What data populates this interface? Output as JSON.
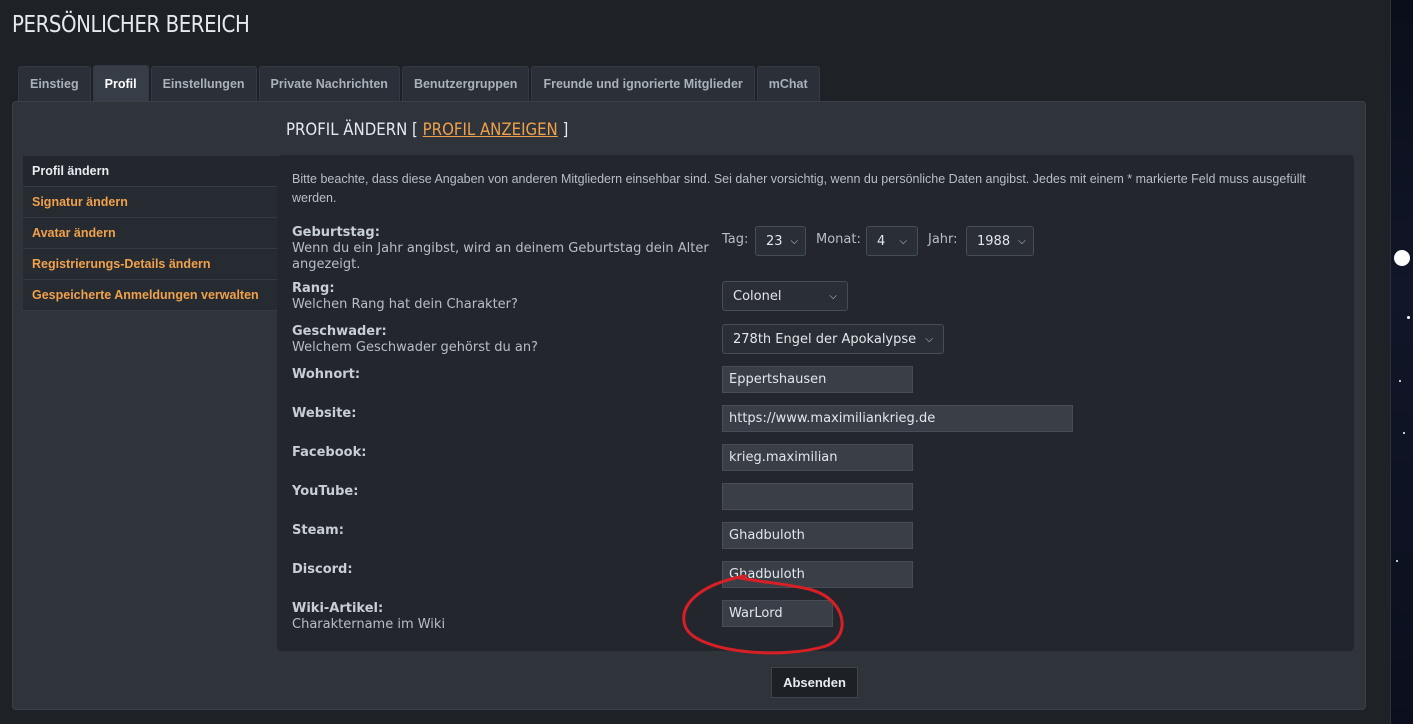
{
  "page_title": "PERSÖNLICHER BEREICH",
  "tabs": [
    {
      "label": "Einstieg",
      "active": false
    },
    {
      "label": "Profil",
      "active": true
    },
    {
      "label": "Einstellungen",
      "active": false
    },
    {
      "label": "Private Nachrichten",
      "active": false
    },
    {
      "label": "Benutzergruppen",
      "active": false
    },
    {
      "label": "Freunde und ignorierte Mitglieder",
      "active": false
    },
    {
      "label": "mChat",
      "active": false
    }
  ],
  "sidebar": {
    "items": [
      {
        "label": "Profil ändern",
        "active": true
      },
      {
        "label": "Signatur ändern",
        "active": false
      },
      {
        "label": "Avatar ändern",
        "active": false
      },
      {
        "label": "Registrierungs-Details ändern",
        "active": false
      },
      {
        "label": "Gespeicherte Anmeldungen verwalten",
        "active": false
      }
    ]
  },
  "content": {
    "heading": "PROFIL ÄNDERN",
    "bracket_open": "[",
    "view_link": "PROFIL ANZEIGEN",
    "bracket_close": "]",
    "intro": "Bitte beachte, dass diese Angaben von anderen Mitgliedern einsehbar sind. Sei daher vorsichtig, wenn du persönliche Daten angibst. Jedes mit einem * markierte Feld muss ausgefüllt werden."
  },
  "birthday": {
    "label": "Geburtstag:",
    "description": "Wenn du ein Jahr angibst, wird an deinem Geburtstag dein Alter angezeigt.",
    "day_label": "Tag:",
    "day_value": "23",
    "month_label": "Monat:",
    "month_value": "4",
    "year_label": "Jahr:",
    "year_value": "1988"
  },
  "rank": {
    "label": "Rang:",
    "description": "Welchen Rang hat dein Charakter?",
    "value": "Colonel"
  },
  "squadron": {
    "label": "Geschwader:",
    "description": "Welchem Geschwader gehörst du an?",
    "value": "278th Engel der Apokalypse"
  },
  "fields": {
    "location": {
      "label": "Wohnort:",
      "value": "Eppertshausen"
    },
    "website": {
      "label": "Website:",
      "value": "https://www.maximiliankrieg.de"
    },
    "facebook": {
      "label": "Facebook:",
      "value": "krieg.maximilian"
    },
    "youtube": {
      "label": "YouTube:",
      "value": ""
    },
    "steam": {
      "label": "Steam:",
      "value": "Ghadbuloth"
    },
    "discord": {
      "label": "Discord:",
      "value": "Ghadbuloth"
    },
    "wiki": {
      "label": "Wiki-Artikel:",
      "description": "Charaktername im Wiki",
      "value": "WarLord"
    }
  },
  "submit_label": "Absenden",
  "colors": {
    "accent": "#f0a14a",
    "annotation": "#d81f26"
  }
}
